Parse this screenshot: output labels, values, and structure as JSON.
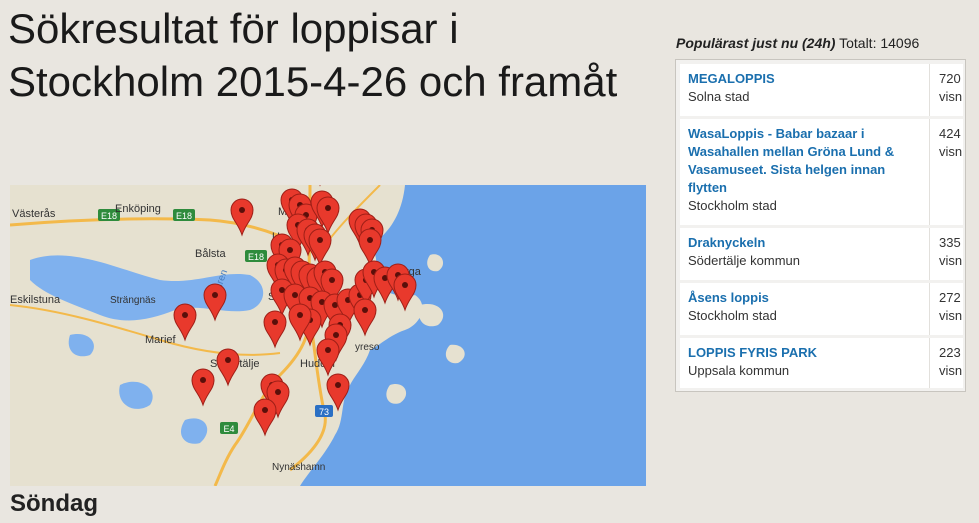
{
  "page": {
    "title": "Sökresultat för loppisar i Stockholm 2015-4-26 och framåt",
    "top_link": "...",
    "day_heading": "Söndag"
  },
  "map": {
    "labels": {
      "vasteras": "Västerås",
      "enkoping": "Enköping",
      "marsta": "Märsta",
      "balsta": "Bålsta",
      "eskilstuna": "Eskilstuna",
      "strangnas": "Strängnäs",
      "malaren": "Mälaren",
      "solna": "Soln",
      "akersberga": "kersberga",
      "mariefred": "Marief",
      "sodertalje": "Södertälje",
      "huddinge": "Huddin",
      "nynashamn": "Nynäshamn",
      "tyreso": "yreso",
      "upplands": "Up"
    },
    "road_shields": [
      "E18",
      "E18",
      "E18",
      "E4",
      "73"
    ],
    "colors": {
      "water": "#6ba3e8",
      "land": "#e6e1d0",
      "pin": "#e8392c"
    }
  },
  "popular": {
    "header_label": "Populärast just nu (24h)",
    "total_label": "Totalt: 14096",
    "items": [
      {
        "name": "MEGALOPPIS",
        "place": "Solna stad",
        "count": "720",
        "unit": "visn"
      },
      {
        "name": "WasaLoppis - Babar bazaar i Wasahallen mellan Gröna Lund & Vasamuseet. Sista helgen innan flytten",
        "place": "Stockholm stad",
        "count": "424",
        "unit": "visn"
      },
      {
        "name": "Draknyckeln",
        "place": "Södertälje kommun",
        "count": "335",
        "unit": "visn"
      },
      {
        "name": "Åsens loppis",
        "place": "Stockholm stad",
        "count": "272",
        "unit": "visn"
      },
      {
        "name": "LOPPIS FYRIS PARK",
        "place": "Uppsala kommun",
        "count": "223",
        "unit": "visn"
      }
    ]
  }
}
